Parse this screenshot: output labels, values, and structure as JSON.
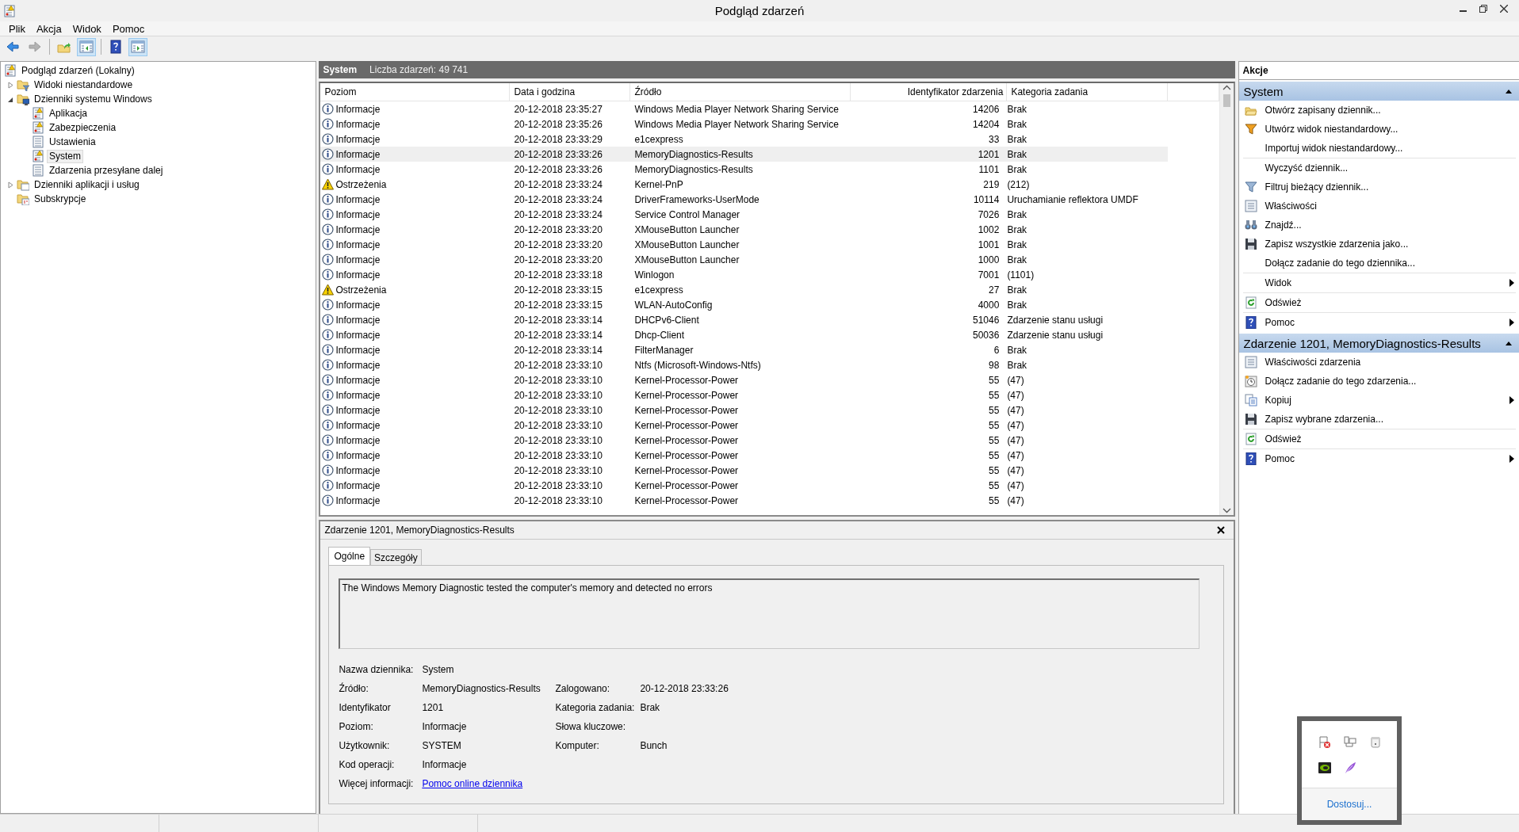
{
  "window": {
    "title": "Podgląd zdarzeń"
  },
  "menu": [
    "Plik",
    "Akcja",
    "Widok",
    "Pomoc"
  ],
  "toolbar": [
    {
      "kind": "back",
      "disabled": false,
      "pressed": false
    },
    {
      "kind": "forward",
      "disabled": true,
      "pressed": false
    },
    {
      "kind": "up",
      "disabled": false,
      "pressed": false
    },
    {
      "kind": "tree",
      "disabled": false,
      "pressed": true
    },
    {
      "kind": "help",
      "disabled": false,
      "pressed": false
    },
    {
      "kind": "actions",
      "disabled": false,
      "pressed": true
    }
  ],
  "tree": [
    {
      "label": "Podgląd zdarzeń (Lokalny)",
      "kind": "root",
      "selected": false,
      "children": [
        {
          "label": "Widoki niestandardowe",
          "kind": "filter-folder",
          "selected": false,
          "expanded": false
        },
        {
          "label": "Dzienniki systemu Windows",
          "kind": "pc-folder",
          "selected": false,
          "expanded": true,
          "children": [
            {
              "label": "Aplikacja",
              "kind": "log-warn",
              "selected": false
            },
            {
              "label": "Zabezpieczenia",
              "kind": "log-warn",
              "selected": false
            },
            {
              "label": "Ustawienia",
              "kind": "log",
              "selected": false
            },
            {
              "label": "System",
              "kind": "log-warn",
              "selected": true
            },
            {
              "label": "Zdarzenia przesyłane dalej",
              "kind": "log",
              "selected": false
            }
          ]
        },
        {
          "label": "Dzienniki aplikacji i usług",
          "kind": "folder",
          "selected": false,
          "expanded": false
        },
        {
          "label": "Subskrypcje",
          "kind": "sub-folder",
          "selected": false
        }
      ]
    }
  ],
  "log_header": {
    "name": "System",
    "count": "Liczba zdarzeń: 49 741"
  },
  "table": {
    "columns": [
      "Poziom",
      "Data i godzina",
      "Źródło",
      "Identyfikator zdarzenia",
      "Kategoria zadania"
    ],
    "rows": [
      {
        "kind": "info",
        "level": "Informacje",
        "date": "20-12-2018 23:35:27",
        "source": "Windows Media Player Network Sharing Service",
        "id": "14206",
        "category": "Brak",
        "selected": false
      },
      {
        "kind": "info",
        "level": "Informacje",
        "date": "20-12-2018 23:35:26",
        "source": "Windows Media Player Network Sharing Service",
        "id": "14204",
        "category": "Brak",
        "selected": false
      },
      {
        "kind": "info",
        "level": "Informacje",
        "date": "20-12-2018 23:33:29",
        "source": "e1cexpress",
        "id": "33",
        "category": "Brak",
        "selected": false
      },
      {
        "kind": "info",
        "level": "Informacje",
        "date": "20-12-2018 23:33:26",
        "source": "MemoryDiagnostics-Results",
        "id": "1201",
        "category": "Brak",
        "selected": true
      },
      {
        "kind": "info",
        "level": "Informacje",
        "date": "20-12-2018 23:33:26",
        "source": "MemoryDiagnostics-Results",
        "id": "1101",
        "category": "Brak",
        "selected": false
      },
      {
        "kind": "warning",
        "level": "Ostrzeżenia",
        "date": "20-12-2018 23:33:24",
        "source": "Kernel-PnP",
        "id": "219",
        "category": "(212)",
        "selected": false
      },
      {
        "kind": "info",
        "level": "Informacje",
        "date": "20-12-2018 23:33:24",
        "source": "DriverFrameworks-UserMode",
        "id": "10114",
        "category": "Uruchamianie reflektora UMDF",
        "selected": false
      },
      {
        "kind": "info",
        "level": "Informacje",
        "date": "20-12-2018 23:33:24",
        "source": "Service Control Manager",
        "id": "7026",
        "category": "Brak",
        "selected": false
      },
      {
        "kind": "info",
        "level": "Informacje",
        "date": "20-12-2018 23:33:20",
        "source": "XMouseButton Launcher",
        "id": "1002",
        "category": "Brak",
        "selected": false
      },
      {
        "kind": "info",
        "level": "Informacje",
        "date": "20-12-2018 23:33:20",
        "source": "XMouseButton Launcher",
        "id": "1001",
        "category": "Brak",
        "selected": false
      },
      {
        "kind": "info",
        "level": "Informacje",
        "date": "20-12-2018 23:33:20",
        "source": "XMouseButton Launcher",
        "id": "1000",
        "category": "Brak",
        "selected": false
      },
      {
        "kind": "info",
        "level": "Informacje",
        "date": "20-12-2018 23:33:18",
        "source": "Winlogon",
        "id": "7001",
        "category": "(1101)",
        "selected": false
      },
      {
        "kind": "warning",
        "level": "Ostrzeżenia",
        "date": "20-12-2018 23:33:15",
        "source": "e1cexpress",
        "id": "27",
        "category": "Brak",
        "selected": false
      },
      {
        "kind": "info",
        "level": "Informacje",
        "date": "20-12-2018 23:33:15",
        "source": "WLAN-AutoConfig",
        "id": "4000",
        "category": "Brak",
        "selected": false
      },
      {
        "kind": "info",
        "level": "Informacje",
        "date": "20-12-2018 23:33:14",
        "source": "DHCPv6-Client",
        "id": "51046",
        "category": "Zdarzenie stanu usługi",
        "selected": false
      },
      {
        "kind": "info",
        "level": "Informacje",
        "date": "20-12-2018 23:33:14",
        "source": "Dhcp-Client",
        "id": "50036",
        "category": "Zdarzenie stanu usługi",
        "selected": false
      },
      {
        "kind": "info",
        "level": "Informacje",
        "date": "20-12-2018 23:33:14",
        "source": "FilterManager",
        "id": "6",
        "category": "Brak",
        "selected": false
      },
      {
        "kind": "info",
        "level": "Informacje",
        "date": "20-12-2018 23:33:10",
        "source": "Ntfs (Microsoft-Windows-Ntfs)",
        "id": "98",
        "category": "Brak",
        "selected": false
      },
      {
        "kind": "info",
        "level": "Informacje",
        "date": "20-12-2018 23:33:10",
        "source": "Kernel-Processor-Power",
        "id": "55",
        "category": "(47)",
        "selected": false
      },
      {
        "kind": "info",
        "level": "Informacje",
        "date": "20-12-2018 23:33:10",
        "source": "Kernel-Processor-Power",
        "id": "55",
        "category": "(47)",
        "selected": false
      },
      {
        "kind": "info",
        "level": "Informacje",
        "date": "20-12-2018 23:33:10",
        "source": "Kernel-Processor-Power",
        "id": "55",
        "category": "(47)",
        "selected": false
      },
      {
        "kind": "info",
        "level": "Informacje",
        "date": "20-12-2018 23:33:10",
        "source": "Kernel-Processor-Power",
        "id": "55",
        "category": "(47)",
        "selected": false
      },
      {
        "kind": "info",
        "level": "Informacje",
        "date": "20-12-2018 23:33:10",
        "source": "Kernel-Processor-Power",
        "id": "55",
        "category": "(47)",
        "selected": false
      },
      {
        "kind": "info",
        "level": "Informacje",
        "date": "20-12-2018 23:33:10",
        "source": "Kernel-Processor-Power",
        "id": "55",
        "category": "(47)",
        "selected": false
      },
      {
        "kind": "info",
        "level": "Informacje",
        "date": "20-12-2018 23:33:10",
        "source": "Kernel-Processor-Power",
        "id": "55",
        "category": "(47)",
        "selected": false
      },
      {
        "kind": "info",
        "level": "Informacje",
        "date": "20-12-2018 23:33:10",
        "source": "Kernel-Processor-Power",
        "id": "55",
        "category": "(47)",
        "selected": false
      },
      {
        "kind": "info",
        "level": "Informacje",
        "date": "20-12-2018 23:33:10",
        "source": "Kernel-Processor-Power",
        "id": "55",
        "category": "(47)",
        "selected": false
      }
    ]
  },
  "detail": {
    "title": "Zdarzenie 1201, MemoryDiagnostics-Results",
    "tabs": [
      {
        "label": "Ogólne",
        "selected": true
      },
      {
        "label": "Szczegóły",
        "selected": false
      }
    ],
    "message": "The Windows Memory Diagnostic tested the computer's memory and detected no errors",
    "fields": [
      [
        {
          "label": "Nazwa dziennika:",
          "value": "System"
        }
      ],
      [
        {
          "label": "Źródło:",
          "value": "MemoryDiagnostics-Results"
        },
        {
          "label": "Zalogowano:",
          "value": "20-12-2018 23:33:26"
        }
      ],
      [
        {
          "label": "Identyfikator",
          "value": "1201"
        },
        {
          "label": "Kategoria zadania:",
          "value": "Brak"
        }
      ],
      [
        {
          "label": "Poziom:",
          "value": "Informacje"
        },
        {
          "label": "Słowa kluczowe:"
        }
      ],
      [
        {
          "label": "Użytkownik:",
          "value": "SYSTEM"
        },
        {
          "label": "Komputer:",
          "value": "Bunch"
        }
      ],
      [
        {
          "label": "Kod operacji:",
          "value": "Informacje"
        }
      ],
      [
        {
          "label": "Więcej informacji:",
          "link": "Pomoc online dziennika"
        }
      ]
    ]
  },
  "actions": {
    "title": "Akcje",
    "sections": [
      {
        "title": "System",
        "expanded": true,
        "groups": [
          [
            {
              "label": "Otwórz zapisany dziennik...",
              "kind": "folder",
              "submenu": false
            },
            {
              "label": "Utwórz widok niestandardowy...",
              "kind": "funnel-new",
              "submenu": false
            },
            {
              "label": "Importuj widok niestandardowy...",
              "kind": "none",
              "submenu": false
            }
          ],
          [
            {
              "label": "Wyczyść dziennik...",
              "kind": "none",
              "submenu": false
            },
            {
              "label": "Filtruj bieżący dziennik...",
              "kind": "funnel",
              "submenu": false
            },
            {
              "label": "Właściwości",
              "kind": "properties",
              "submenu": false
            },
            {
              "label": "Znajdź...",
              "kind": "binoculars",
              "submenu": false
            },
            {
              "label": "Zapisz wszystkie zdarzenia jako...",
              "kind": "disk",
              "submenu": false
            },
            {
              "label": "Dołącz zadanie do tego dziennika...",
              "kind": "none",
              "submenu": false
            }
          ],
          [
            {
              "label": "Widok",
              "kind": "none",
              "submenu": true
            }
          ],
          [
            {
              "label": "Odśwież",
              "kind": "refresh",
              "submenu": false
            }
          ],
          [
            {
              "label": "Pomoc",
              "kind": "help",
              "submenu": true
            }
          ]
        ]
      },
      {
        "title": "Zdarzenie 1201, MemoryDiagnostics-Results",
        "expanded": true,
        "groups": [
          [
            {
              "label": "Właściwości zdarzenia",
              "kind": "properties",
              "submenu": false
            },
            {
              "label": "Dołącz zadanie do tego zdarzenia...",
              "kind": "clock",
              "submenu": false
            },
            {
              "label": "Kopiuj",
              "kind": "copy",
              "submenu": true
            },
            {
              "label": "Zapisz wybrane zdarzenia...",
              "kind": "disk",
              "submenu": false
            }
          ],
          [
            {
              "label": "Odśwież",
              "kind": "refresh",
              "submenu": false
            }
          ],
          [
            {
              "label": "Pomoc",
              "kind": "help",
              "submenu": true
            }
          ]
        ]
      }
    ]
  },
  "tray_popup": {
    "icons": [
      {
        "kind": "flag-error"
      },
      {
        "kind": "network"
      },
      {
        "kind": "usb"
      },
      {
        "kind": "gpu"
      },
      {
        "kind": "feather"
      }
    ],
    "link": "Dostosuj..."
  }
}
